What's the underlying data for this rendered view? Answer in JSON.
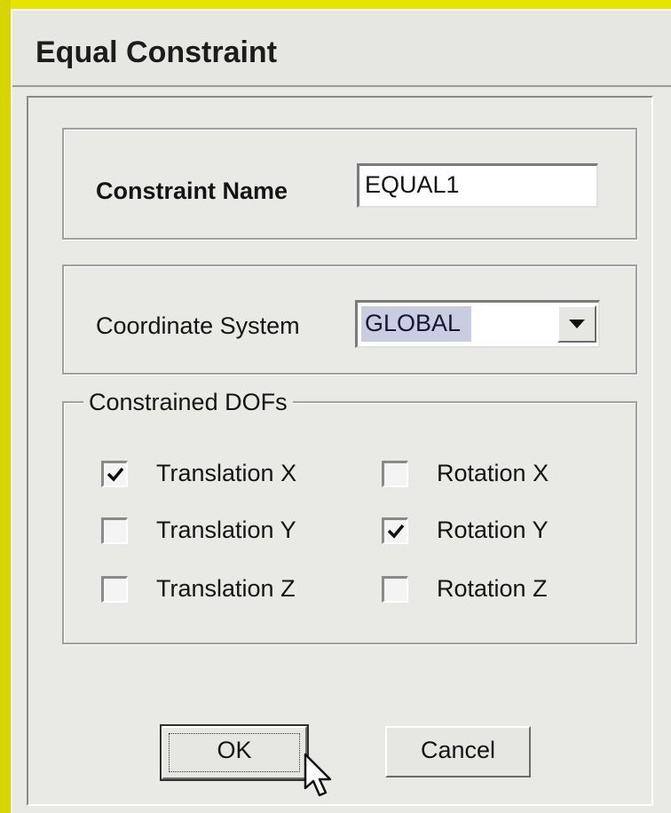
{
  "dialog": {
    "title": "Equal Constraint"
  },
  "constraint_name": {
    "label": "Constraint Name",
    "value": "EQUAL1"
  },
  "coordinate_system": {
    "label": "Coordinate System",
    "selected": "GLOBAL",
    "icon": "chevron-down-icon"
  },
  "dofs": {
    "legend": "Constrained DOFs",
    "items": [
      {
        "label": "Translation X",
        "checked": true
      },
      {
        "label": "Translation Y",
        "checked": false
      },
      {
        "label": "Translation Z",
        "checked": false
      },
      {
        "label": "Rotation X",
        "checked": false
      },
      {
        "label": "Rotation Y",
        "checked": true
      },
      {
        "label": "Rotation Z",
        "checked": false
      }
    ]
  },
  "buttons": {
    "ok": "OK",
    "cancel": "Cancel"
  },
  "colors": {
    "background": "#e6e400",
    "dialog": "#e9e9e6",
    "selection": "#c9cde2"
  }
}
